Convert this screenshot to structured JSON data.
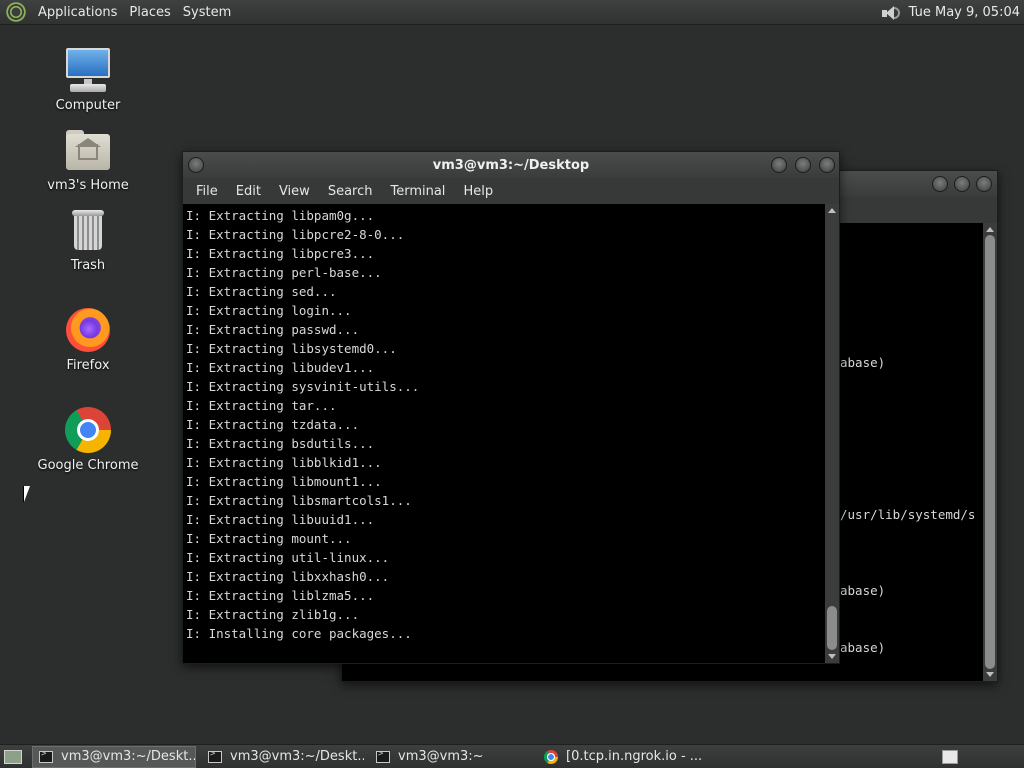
{
  "top_panel": {
    "menus": [
      "Applications",
      "Places",
      "System"
    ],
    "clock": "Tue May  9, 05:04",
    "icons": {
      "menu_logo": "distro-logo-icon",
      "volume": "speaker-icon"
    }
  },
  "desktop": {
    "icons": [
      {
        "label": "Computer",
        "icon": "computer-icon"
      },
      {
        "label": "vm3's Home",
        "icon": "home-folder-icon"
      },
      {
        "label": "Trash",
        "icon": "trash-icon"
      },
      {
        "label": "Firefox",
        "icon": "firefox-icon"
      },
      {
        "label": "Google Chrome",
        "icon": "chrome-icon"
      }
    ]
  },
  "front_window": {
    "title": "vm3@vm3:~/Desktop",
    "menu": [
      "File",
      "Edit",
      "View",
      "Search",
      "Terminal",
      "Help"
    ],
    "lines": [
      "I: Extracting libpam0g...",
      "I: Extracting libpcre2-8-0...",
      "I: Extracting libpcre3...",
      "I: Extracting perl-base...",
      "I: Extracting sed...",
      "I: Extracting login...",
      "I: Extracting passwd...",
      "I: Extracting libsystemd0...",
      "I: Extracting libudev1...",
      "I: Extracting sysvinit-utils...",
      "I: Extracting tar...",
      "I: Extracting tzdata...",
      "I: Extracting bsdutils...",
      "I: Extracting libblkid1...",
      "I: Extracting libmount1...",
      "I: Extracting libsmartcols1...",
      "I: Extracting libuuid1...",
      "I: Extracting mount...",
      "I: Extracting util-linux...",
      "I: Extracting libxxhash0...",
      "I: Extracting liblzma5...",
      "I: Extracting zlib1g...",
      "I: Installing core packages..."
    ]
  },
  "back_window": {
    "visible_fragments": [
      {
        "text": "abase)",
        "row": 4
      },
      {
        "text": "/usr/lib/systemd/s",
        "row": 12
      },
      {
        "text": "abase)",
        "row": 16
      },
      {
        "text": "abase)",
        "row": 19
      }
    ]
  },
  "taskbar": {
    "tasks": [
      {
        "label": "vm3@vm3:~/Deskt...",
        "icon": "terminal-icon",
        "active": true
      },
      {
        "label": "vm3@vm3:~/Deskt...",
        "icon": "terminal-icon",
        "active": false
      },
      {
        "label": "vm3@vm3:~",
        "icon": "terminal-icon",
        "active": false
      },
      {
        "label": "[0.tcp.in.ngrok.io - ...",
        "icon": "chrome-icon",
        "active": false
      }
    ]
  }
}
